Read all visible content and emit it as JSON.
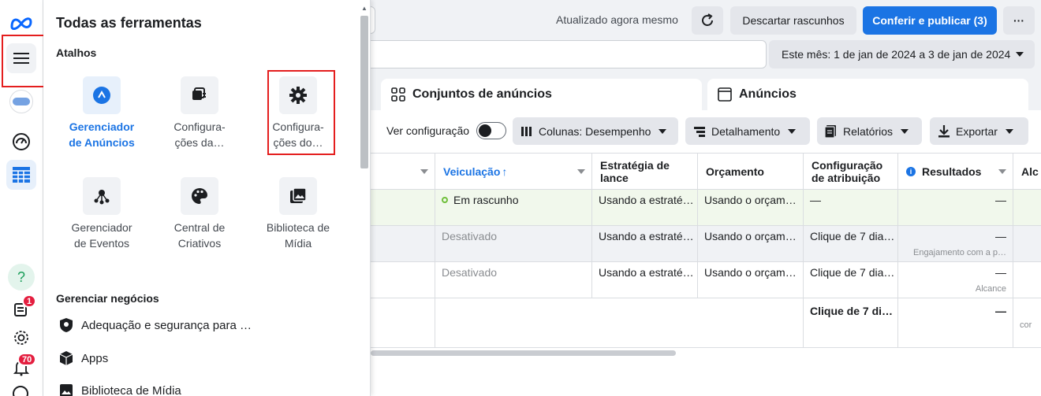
{
  "rail": {
    "items": [
      "meta-logo-icon",
      "menu-icon",
      "account-avatar",
      "performance-icon",
      "ads-manager-grid-icon",
      "help-icon",
      "notifications-pages-icon",
      "settings-icon",
      "bell-icon"
    ],
    "badges": {
      "pages": "1",
      "notifications": "70"
    }
  },
  "panel": {
    "title": "Todas as ferramentas",
    "shortcuts_label": "Atalhos",
    "shortcuts": [
      {
        "label_line1": "Gerenciador",
        "label_line2": "de Anúncios",
        "icon": "ads-manager-icon"
      },
      {
        "label_line1": "Configura-",
        "label_line2": "ções da…",
        "icon": "settings-pages-icon"
      },
      {
        "label_line1": "Configura-",
        "label_line2": "ções do…",
        "icon": "gear-icon"
      },
      {
        "label_line1": "Gerenciador",
        "label_line2": "de Eventos",
        "icon": "events-manager-icon"
      },
      {
        "label_line1": "Central de",
        "label_line2": "Criativos",
        "icon": "palette-icon"
      },
      {
        "label_line1": "Biblioteca de",
        "label_line2": "Mídia",
        "icon": "media-library-icon"
      }
    ],
    "business_label": "Gerenciar negócios",
    "business_items": [
      {
        "label": "Adequação e segurança para …",
        "icon": "shield-icon"
      },
      {
        "label": "Apps",
        "icon": "cube-icon"
      },
      {
        "label": "Biblioteca de Mídia",
        "icon": "image-icon"
      }
    ]
  },
  "topbar": {
    "updated": "Atualizado agora mesmo",
    "discard": "Descartar rascunhos",
    "publish": "Conferir e publicar (3)",
    "more": "···",
    "date_range": "Este mês: 1 de jan de 2024 a 3 de jan de 2024"
  },
  "tabs": {
    "adsets": "Conjuntos de anúncios",
    "ads": "Anúncios"
  },
  "toolbar": {
    "view_setup": "Ver configuração",
    "columns": "Colunas: Desempenho",
    "breakdown": "Detalhamento",
    "reports": "Relatórios",
    "export": "Exportar"
  },
  "table": {
    "headers": {
      "delivery": "Veiculação",
      "bid_strategy_line1": "Estratégia de",
      "bid_strategy_line2": "lance",
      "budget": "Orçamento",
      "attribution_line1": "Configuração",
      "attribution_line2": "de atribuição",
      "results": "Resultados",
      "reach_partial": "Alc"
    },
    "rows": [
      {
        "delivery": "Em rascunho",
        "bid": "Usando a estraté…",
        "budget": "Usando o orçam…",
        "attribution": "—",
        "results": "—",
        "results_sub": "",
        "last": "—"
      },
      {
        "delivery": "Desativado",
        "bid": "Usando a estraté…",
        "budget": "Usando o orçam…",
        "attribution": "Clique de 7 dia…",
        "results": "—",
        "results_sub": "Engajamento com a p…",
        "last": "—"
      },
      {
        "delivery": "Desativado",
        "bid": "Usando a estraté…",
        "budget": "Usando o orçam…",
        "attribution": "Clique de 7 dia…",
        "results": "—",
        "results_sub": "Alcance",
        "last": "—"
      }
    ],
    "total": {
      "attribution": "Clique de 7 di…",
      "results": "—",
      "last_partial": "cor"
    }
  }
}
